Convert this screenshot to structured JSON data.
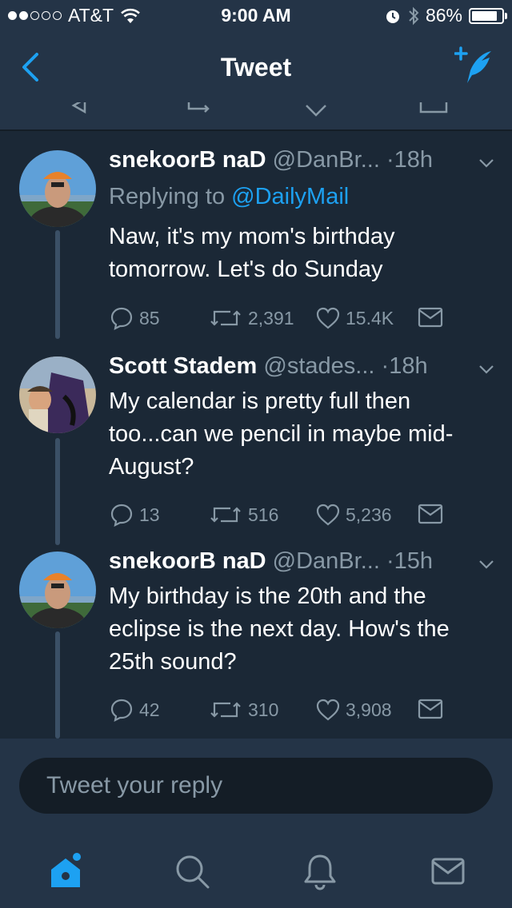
{
  "status_bar": {
    "carrier": "AT&T",
    "time": "9:00 AM",
    "battery": "86%",
    "battery_level": 0.86,
    "signal_bars_filled": 2,
    "signal_bars_total": 5
  },
  "nav": {
    "title": "Tweet",
    "back_icon": "chevron-left-icon",
    "compose_icon": "compose-tweet-icon"
  },
  "tweets": [
    {
      "name": "snekoorB naD",
      "handle": "@DanBr...",
      "time": "18h",
      "replying_prefix": "Replying to",
      "replying_to": "@DailyMail",
      "text": "Naw, it's my mom's birthday tomorrow. Let's do Sunday",
      "replies": "85",
      "retweets": "2,391",
      "likes": "15.4K"
    },
    {
      "name": "Scott Stadem",
      "handle": "@stades...",
      "time": "18h",
      "text": "My calendar is pretty full then too...can we pencil in maybe mid-August?",
      "replies": "13",
      "retweets": "516",
      "likes": "5,236"
    },
    {
      "name": "snekoorB naD",
      "handle": "@DanBr...",
      "time": "15h",
      "text": "My birthday is the 20th and the eclipse is the next day. How's the 25th sound?",
      "replies": "42",
      "retweets": "310",
      "likes": "3,908"
    }
  ],
  "reply_box": {
    "placeholder": "Tweet your reply"
  },
  "tab_bar": {
    "items": [
      "home-icon",
      "search-icon",
      "notifications-icon",
      "messages-icon"
    ]
  },
  "colors": {
    "background": "#1b2836",
    "bar": "#243447",
    "accent": "#1da1f2",
    "secondary_text": "#8899a6"
  }
}
